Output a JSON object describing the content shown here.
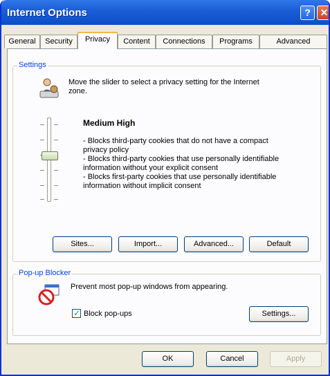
{
  "window": {
    "title": "Internet Options"
  },
  "title_buttons": {
    "help": "?",
    "close": "✕"
  },
  "tabs": [
    "General",
    "Security",
    "Privacy",
    "Content",
    "Connections",
    "Programs",
    "Advanced"
  ],
  "active_tab": "Privacy",
  "settings": {
    "group_label": "Settings",
    "description_line1": "Move the slider to select a privacy setting for the Internet",
    "description_line2": "zone.",
    "level_title": "Medium High",
    "bullet1_line1": "- Blocks third-party cookies that do not have a compact",
    "bullet1_line2": "privacy policy",
    "bullet2_line1": "- Blocks third-party cookies that use personally identifiable",
    "bullet2_line2": "information without your explicit consent",
    "bullet3_line1": "- Blocks first-party cookies that use personally identifiable",
    "bullet3_line2": "information without implicit consent",
    "slider_level": "4 of 6",
    "buttons": {
      "sites": "Sites...",
      "import": "Import...",
      "advanced": "Advanced...",
      "default": "Default"
    }
  },
  "popup_blocker": {
    "group_label": "Pop-up Blocker",
    "description": "Prevent most pop-up windows from appearing.",
    "checkbox_label": "Block pop-ups",
    "checkbox_checked": true,
    "check_mark": "✓",
    "settings_button": "Settings..."
  },
  "footer": {
    "ok": "OK",
    "cancel": "Cancel",
    "apply": "Apply"
  },
  "colors": {
    "titlebar": "#0c4ec8",
    "group_label": "#0046d5",
    "active_tab_accent": "#f4b84a"
  }
}
